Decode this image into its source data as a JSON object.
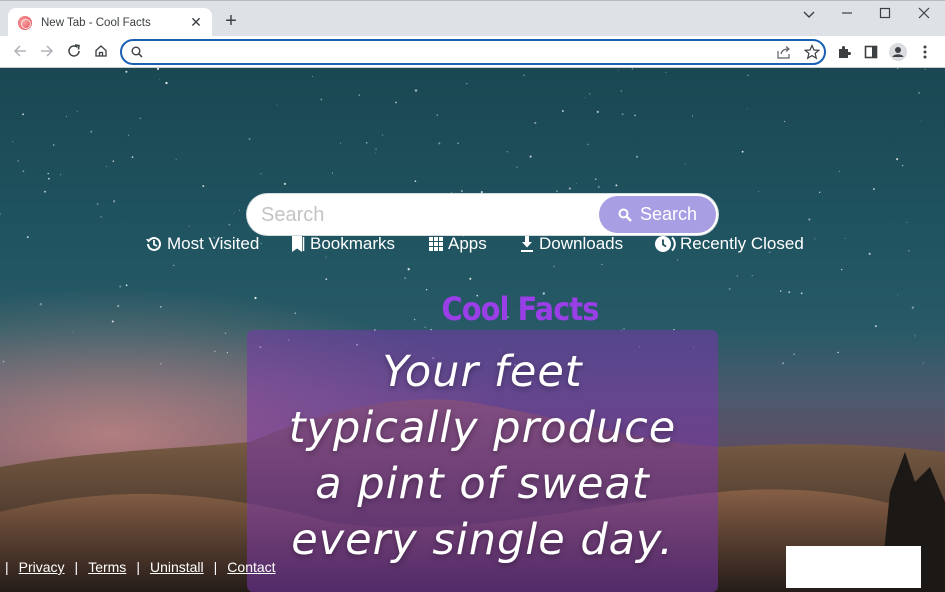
{
  "browser": {
    "tab": {
      "title": "New Tab - Cool Facts",
      "favicon": "cool-facts-favicon"
    },
    "new_tab_label": "+",
    "window_controls": {
      "tab_search": "⌄",
      "minimize": "—",
      "maximize": "☐",
      "close": "✕"
    },
    "omnibox": {
      "value": "",
      "placeholder": ""
    },
    "icons": [
      "back-icon",
      "forward-icon",
      "reload-icon",
      "home-icon",
      "search-icon",
      "share-icon",
      "star-icon",
      "extensions-icon",
      "side-panel-icon",
      "profile-icon",
      "menu-icon"
    ]
  },
  "page": {
    "search": {
      "placeholder": "Search",
      "button_label": "Search"
    },
    "shortcuts": [
      {
        "label": "Most Visited",
        "icon": "history-icon"
      },
      {
        "label": "Bookmarks",
        "icon": "bookmark-icon"
      },
      {
        "label": "Apps",
        "icon": "apps-grid-icon"
      },
      {
        "label": "Downloads",
        "icon": "download-icon"
      },
      {
        "label": "Recently Closed",
        "icon": "clock-icon"
      }
    ],
    "brand": "Cool Facts",
    "fact": "Your feet typically produce a pint of sweat every single day.",
    "footer": {
      "separator": "|",
      "links": [
        "Privacy",
        "Terms",
        "Uninstall",
        "Contact"
      ]
    },
    "colors": {
      "search_button": "#a89ee3",
      "brand": "#9a3fe8",
      "fact_card": "#7837aa",
      "omnibox_focus": "#1a5fb4"
    }
  }
}
